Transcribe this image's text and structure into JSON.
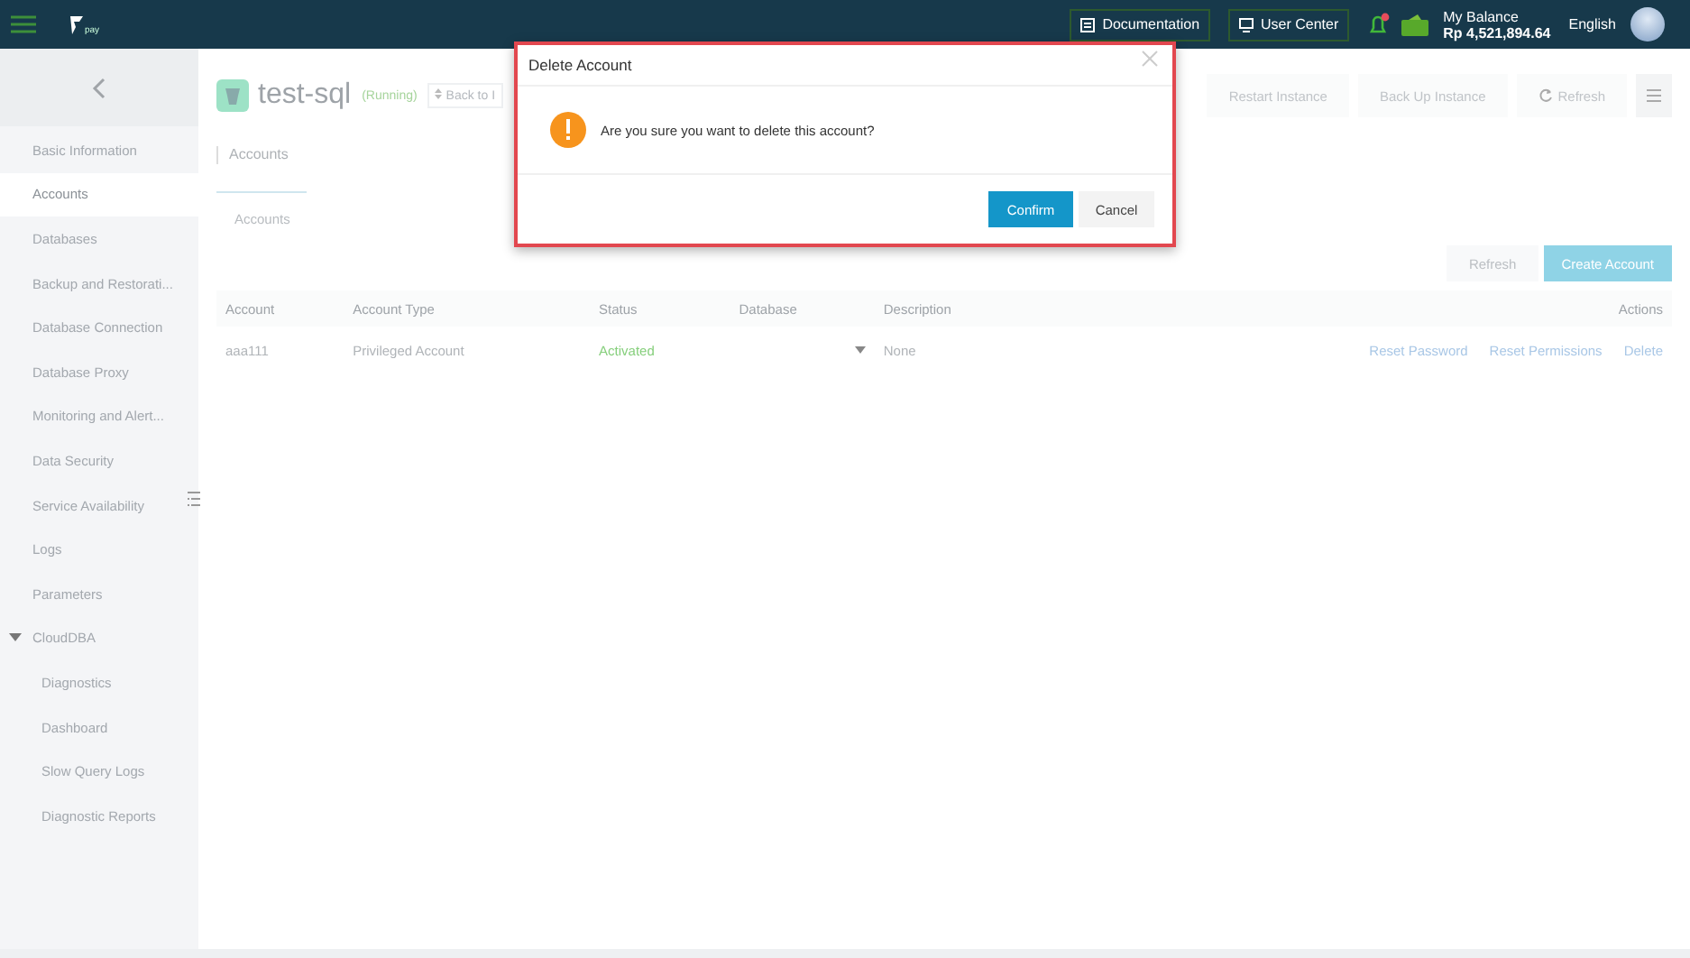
{
  "topbar": {
    "logo_text": "pay",
    "documentation": "Documentation",
    "user_center": "User Center",
    "notification_unread": true,
    "balance_label": "My Balance",
    "balance": "Rp 4,521,894.64",
    "language": "English"
  },
  "sidebar": {
    "items": [
      {
        "label": "Basic Information",
        "selected": false
      },
      {
        "label": "Accounts",
        "selected": true
      },
      {
        "label": "Databases",
        "selected": false
      },
      {
        "label": "Backup and Restorati...",
        "selected": false
      },
      {
        "label": "Database Connection",
        "selected": false
      },
      {
        "label": "Database Proxy",
        "selected": false
      },
      {
        "label": "Monitoring and Alert...",
        "selected": false
      },
      {
        "label": "Data Security",
        "selected": false
      },
      {
        "label": "Service Availability",
        "selected": false
      },
      {
        "label": "Logs",
        "selected": false
      },
      {
        "label": "Parameters",
        "selected": false
      },
      {
        "label": "CloudDBA",
        "selected": false,
        "expanded": true,
        "children": [
          {
            "label": "Diagnostics",
            "selected": false
          },
          {
            "label": "Dashboard",
            "selected": false
          },
          {
            "label": "Slow Query Logs",
            "selected": false
          },
          {
            "label": "Diagnostic Reports",
            "selected": false
          }
        ]
      }
    ]
  },
  "instance": {
    "name": "test-sql",
    "status": "(Running)",
    "back": "Back to I",
    "actions": [
      "Restart Instance",
      "Back Up Instance",
      "Refresh"
    ]
  },
  "section_title": "Accounts",
  "tabs": [
    {
      "label": "Accounts",
      "selected": true
    }
  ],
  "toolbar": {
    "refresh": "Refresh",
    "create": "Create Account"
  },
  "table": {
    "columns": [
      "Account",
      "Account Type",
      "Status",
      "Database",
      "Description",
      "Actions"
    ],
    "rows": [
      {
        "account": "aaa111",
        "type": "Privileged Account",
        "status": "Activated",
        "active": true,
        "description": "None",
        "actions": [
          "Reset Password",
          "Reset Permissions",
          "Delete"
        ]
      }
    ]
  },
  "dialog": {
    "title": "Delete Account",
    "message": "Are you sure you want to delete this account?",
    "confirm": "Confirm",
    "cancel": "Cancel"
  }
}
